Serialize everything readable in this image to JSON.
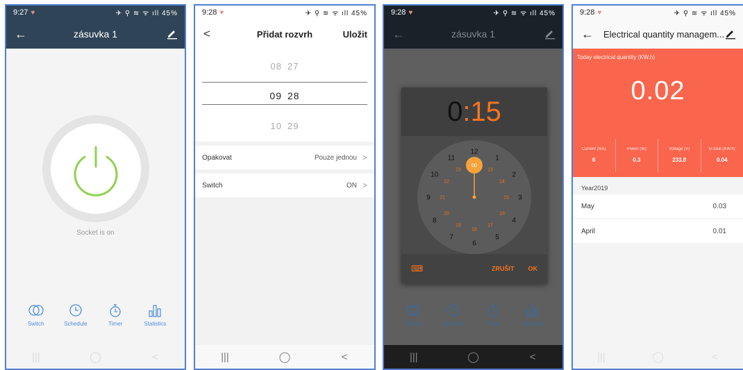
{
  "screen1": {
    "time": "9:27",
    "status_icons": "✈ ⚲ ≋ ᯤ ıll 45%",
    "title": "zásuvka 1",
    "socket_status": "Socket is on",
    "tabs": [
      {
        "label": "Switch",
        "icon": "switch-icon"
      },
      {
        "label": "Schedule",
        "icon": "clock-icon"
      },
      {
        "label": "Timer",
        "icon": "stopwatch-icon"
      },
      {
        "label": "Statistics",
        "icon": "bar-chart-icon"
      }
    ],
    "colors": {
      "header": "#2f4457",
      "power_ring": "#8fd14f",
      "accent": "#4c8ed9"
    }
  },
  "screen2": {
    "time": "9:28",
    "status_icons": "✈ ⚲ ≋ ᯤ ıll 45%",
    "title": "Přidat rozvrh",
    "save_label": "Uložit",
    "picker": {
      "prev": {
        "hour": "08",
        "minute": "27"
      },
      "selected": {
        "hour": "09",
        "minute": "28"
      },
      "next": {
        "hour": "10",
        "minute": "29"
      }
    },
    "settings": [
      {
        "label": "Opakovat",
        "value": "Pouze jednou"
      },
      {
        "label": "Switch",
        "value": "ON"
      }
    ]
  },
  "screen3": {
    "time": "9:28",
    "status_icons": "✈ ⚲ ≋ ᯤ ıll 45%",
    "title": "zásuvka 1",
    "display": {
      "hours": "0",
      "separator": ":",
      "minutes": "15"
    },
    "clock": {
      "hours": [
        "12",
        "1",
        "2",
        "3",
        "4",
        "5",
        "6",
        "7",
        "8",
        "9",
        "10",
        "11"
      ],
      "inner": [
        "00",
        "13",
        "14",
        "15",
        "16",
        "17",
        "18",
        "19",
        "20",
        "21",
        "22",
        "23"
      ],
      "selected_value": "00"
    },
    "cancel_label": "ZRUŠIT",
    "ok_label": "OK",
    "tabs": [
      "Switch",
      "Schedule",
      "Timer",
      "Statistics"
    ],
    "colors": {
      "accent": "#f47421"
    }
  },
  "screen4": {
    "time": "9:28",
    "status_icons": "✈ ⚲ ≋ ᯤ ıll 45%",
    "title": "Electrical quantity managem...",
    "today_label": "Today electrical quantity (KW.h)",
    "today_value": "0.02",
    "stats": [
      {
        "label": "Current (mA)",
        "value": "6"
      },
      {
        "label": "Power (W)",
        "value": "0.3"
      },
      {
        "label": "Voltage (V)",
        "value": "233.8"
      },
      {
        "label": "In total (KW.h)",
        "value": "0.04"
      }
    ],
    "year_label": "Year2019",
    "months": [
      {
        "label": "May",
        "value": "0.03"
      },
      {
        "label": "April",
        "value": "0.01"
      }
    ],
    "colors": {
      "panel": "#f9664d"
    }
  },
  "nav": {
    "recent": "|||",
    "home": "◯",
    "back": "<"
  }
}
